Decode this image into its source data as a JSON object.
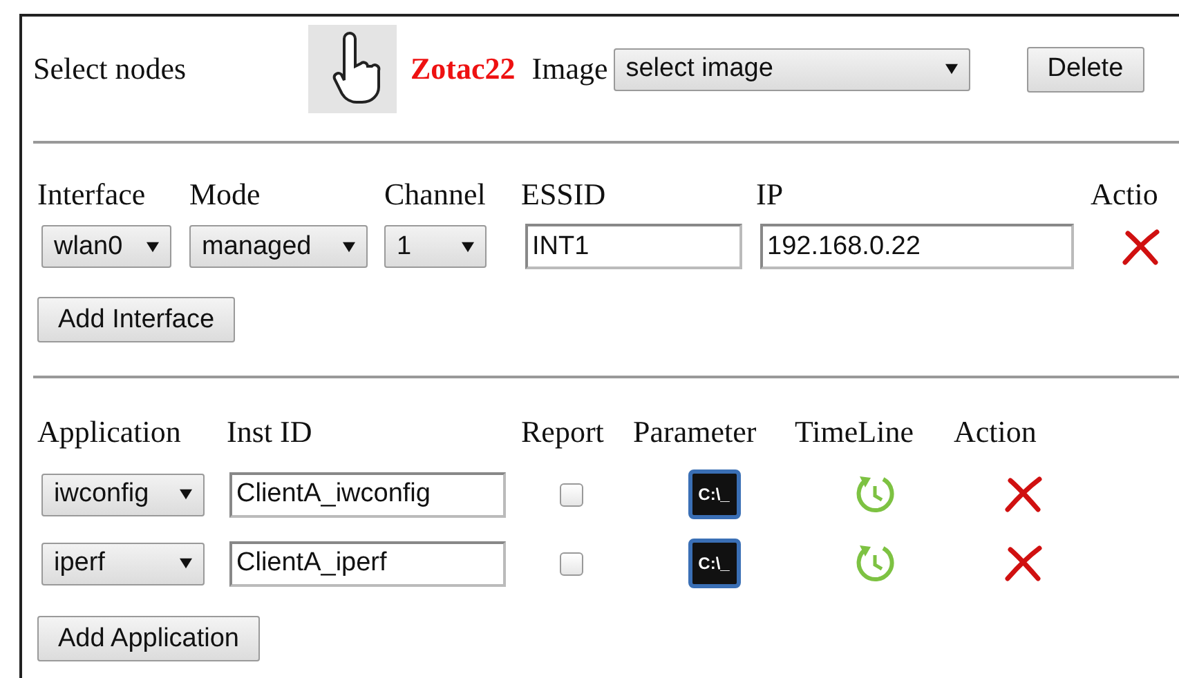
{
  "header": {
    "label": "Select nodes",
    "node": "Zotac22",
    "image_label": "Image",
    "image_select": "select image",
    "delete_button": "Delete"
  },
  "interfaces": {
    "columns": [
      "Interface",
      "Mode",
      "Channel",
      "ESSID",
      "IP",
      "Actio"
    ],
    "rows": [
      {
        "interface": "wlan0",
        "mode": "managed",
        "channel": "1",
        "essid": "INT1",
        "ip": "192.168.0.22"
      }
    ],
    "add_button": "Add Interface"
  },
  "applications": {
    "columns": [
      "Application",
      "Inst ID",
      "Report",
      "Parameter",
      "TimeLine",
      "Action"
    ],
    "rows": [
      {
        "application": "iwconfig",
        "inst_id": "ClientA_iwconfig",
        "report": false,
        "parameter_icon_text": "C:\\_"
      },
      {
        "application": "iperf",
        "inst_id": "ClientA_iperf",
        "report": false,
        "parameter_icon_text": "C:\\_"
      }
    ],
    "add_button": "Add Application"
  }
}
